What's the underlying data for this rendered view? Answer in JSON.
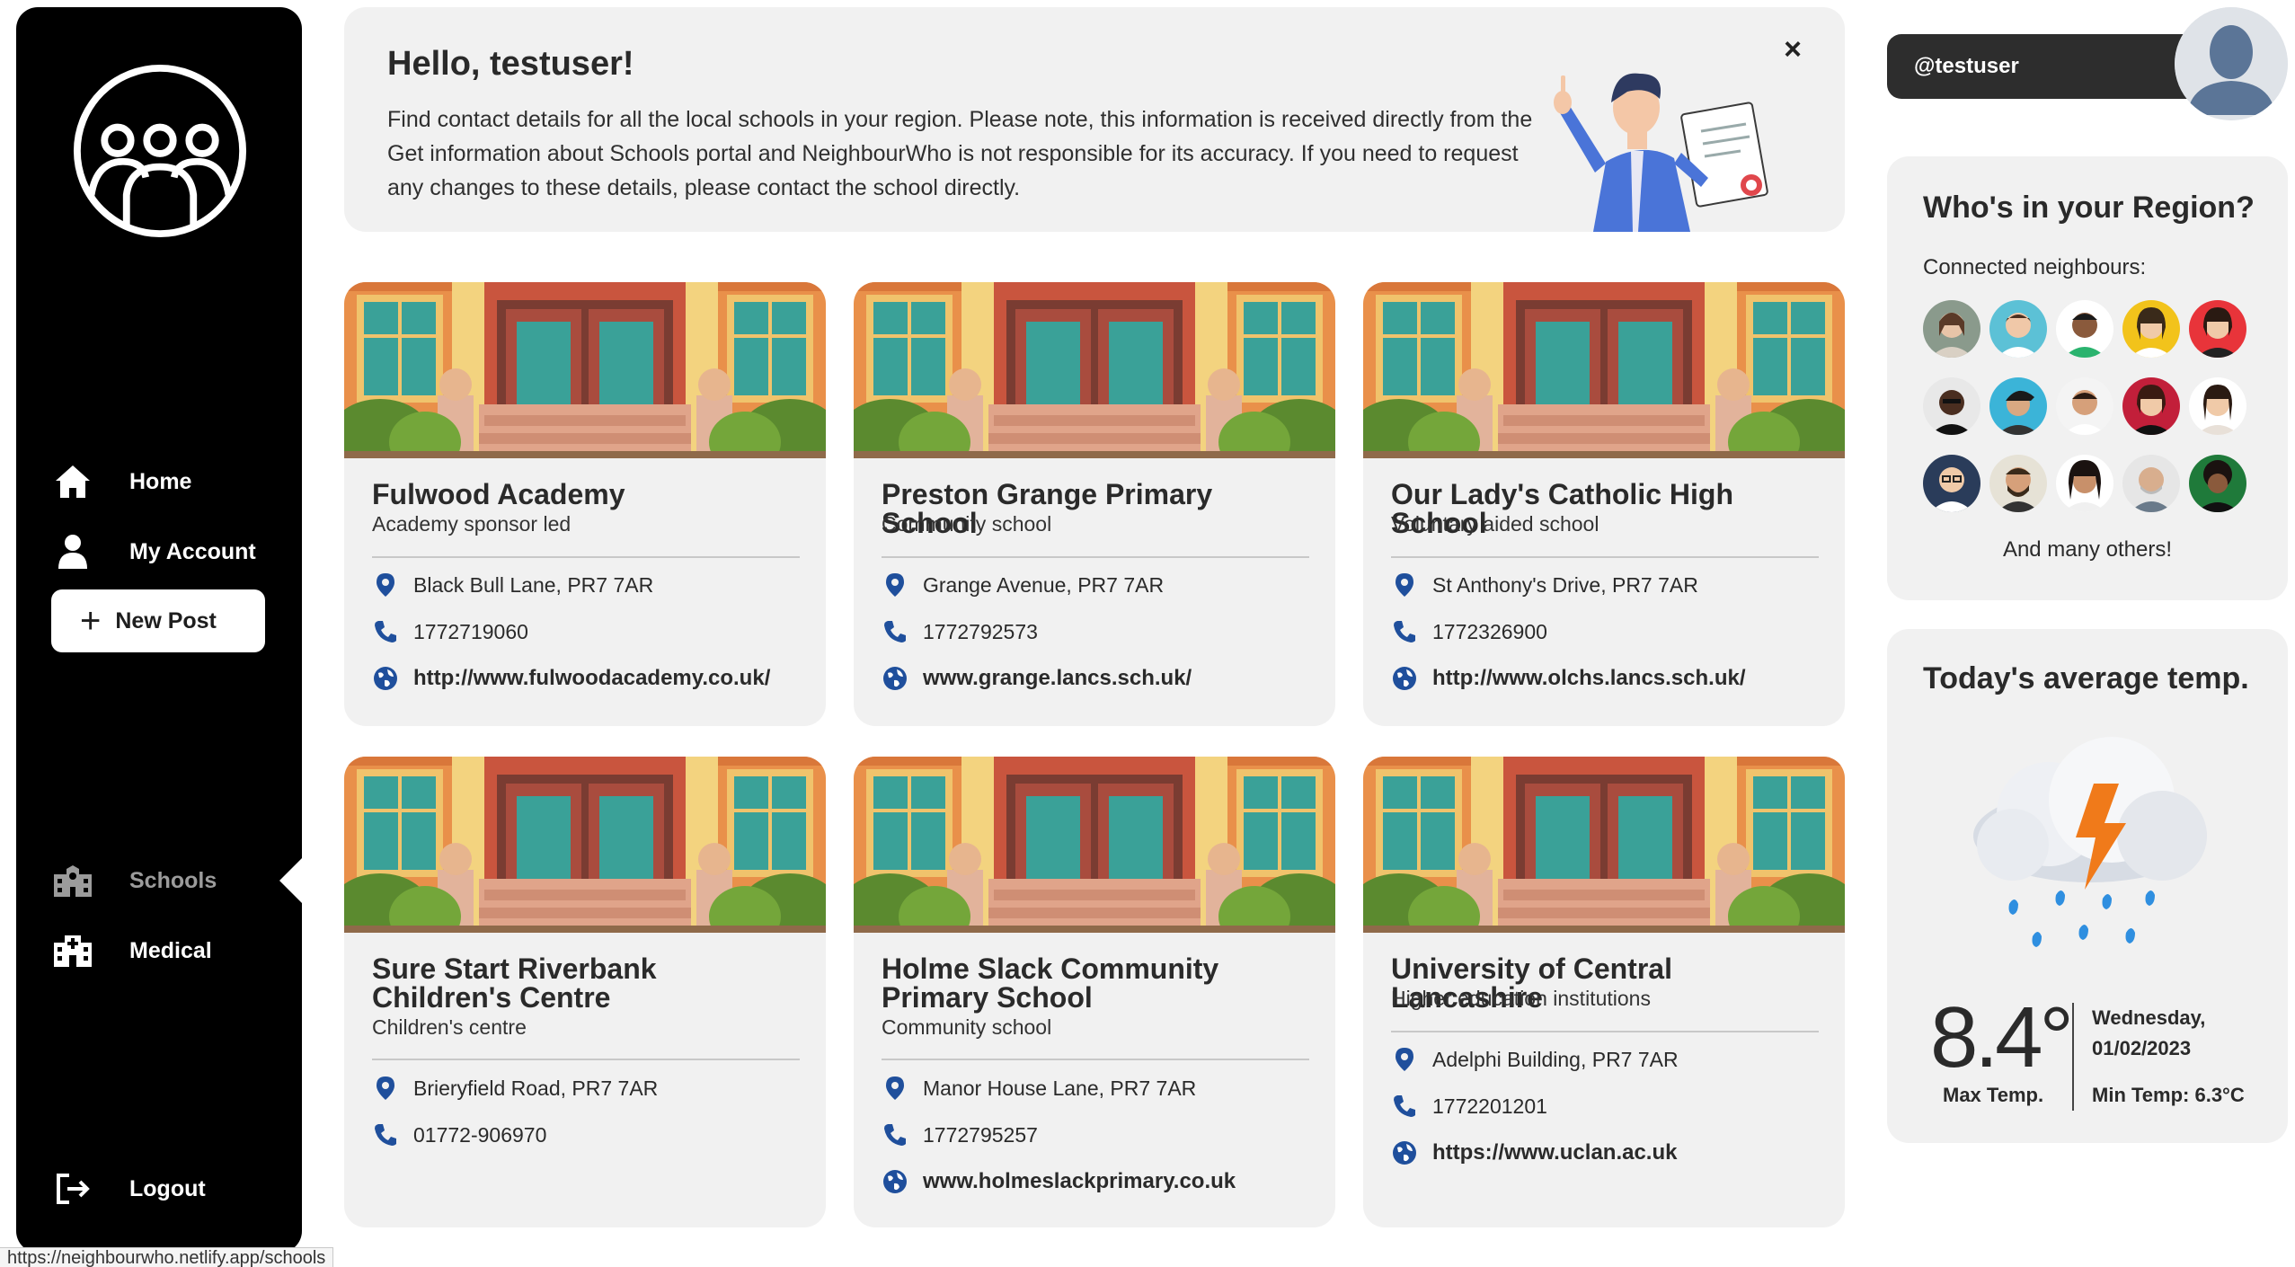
{
  "sidebar": {
    "items": [
      {
        "label": "Home",
        "icon": "home-icon"
      },
      {
        "label": "My Account",
        "icon": "user-icon"
      },
      {
        "label": "Schools",
        "icon": "school-icon"
      },
      {
        "label": "Medical",
        "icon": "hospital-icon"
      }
    ],
    "new_post_label": "New Post",
    "logout_label": "Logout"
  },
  "banner": {
    "title": "Hello, testuser!",
    "text": "Find contact details for all the local schools in your region. Please note, this information is received directly from the Get information about Schools portal and NeighbourWho is not responsible for its accuracy. If you need to request any changes to these details, please contact the school directly.",
    "close": "×"
  },
  "schools": [
    {
      "name": "Fulwood Academy",
      "type": "Academy sponsor led",
      "address": "Black Bull Lane, PR7 7AR",
      "phone": "1772719060",
      "website": "http://www.fulwoodacademy.co.uk/"
    },
    {
      "name": "Preston Grange Primary School",
      "type": "Community school",
      "address": "Grange Avenue, PR7 7AR",
      "phone": "1772792573",
      "website": "www.grange.lancs.sch.uk/"
    },
    {
      "name": "Our Lady's Catholic High School",
      "type": "Voluntary aided school",
      "address": "St Anthony's Drive, PR7 7AR",
      "phone": "1772326900",
      "website": "http://www.olchs.lancs.sch.uk/"
    },
    {
      "name": "Sure Start Riverbank Children's Centre",
      "type": "Children's centre",
      "address": "Brieryfield Road, PR7 7AR",
      "phone": "01772-906970",
      "website": ""
    },
    {
      "name": "Holme Slack Community Primary School",
      "type": "Community school",
      "address": "Manor House Lane, PR7 7AR",
      "phone": "1772795257",
      "website": "www.holmeslackprimary.co.uk"
    },
    {
      "name": "University of Central Lancashire",
      "type": "Higher education institutions",
      "address": "Adelphi Building, PR7 7AR",
      "phone": "1772201201",
      "website": "https://www.uclan.ac.uk"
    }
  ],
  "user": {
    "handle": "@testuser"
  },
  "region": {
    "title": "Who's in your Region?",
    "subtitle": "Connected neighbours:",
    "footer": "And many others!"
  },
  "weather": {
    "title": "Today's average temp.",
    "temp": "8.4°",
    "day": "Wednesday,",
    "date": "01/02/2023",
    "max_label": "Max Temp.",
    "min_label": "Min Temp: 6.3°C"
  },
  "status_url": "https://neighbourwho.netlify.app/schools",
  "colors": {
    "accent_blue": "#1f4f9c",
    "sidebar_bg": "#000000",
    "card_bg": "#f1f1f1"
  }
}
